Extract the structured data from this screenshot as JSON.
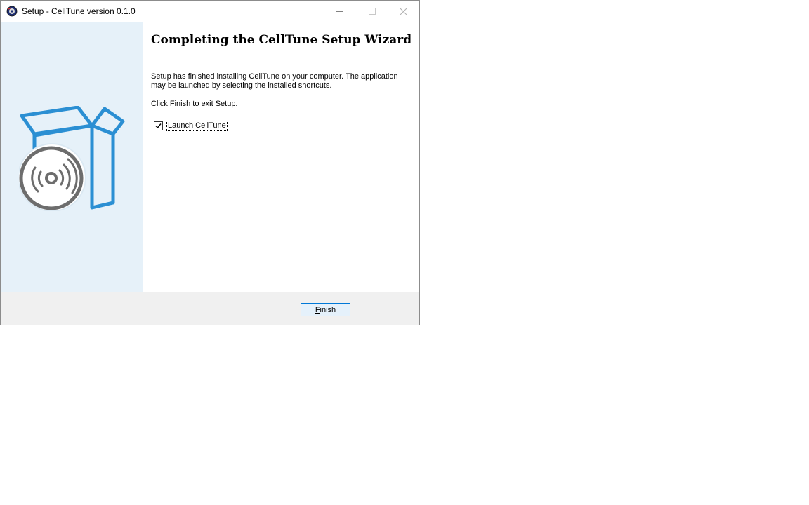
{
  "window": {
    "title": "Setup - CellTune version 0.1.0"
  },
  "titlebar_icons": {
    "app": "setup-app-icon",
    "minimize": "minimize-icon",
    "maximize": "maximize-icon",
    "close": "close-icon"
  },
  "sidebar": {
    "art": "software-box-disc-icon",
    "art_color": "#2b8fd3",
    "disc_color": "#6d6d6d"
  },
  "content": {
    "heading": "Completing the CellTune Setup Wizard",
    "paragraph1": "Setup has finished installing CellTune on your computer. The application may be launched by selecting the installed shortcuts.",
    "paragraph2": "Click Finish to exit Setup.",
    "launch_checkbox": {
      "label": "Launch CellTune",
      "checked": true
    }
  },
  "footer": {
    "finish_button": {
      "mnemonic": "F",
      "rest": "inish"
    }
  },
  "colors": {
    "sidebar_bg": "#e6f1f9",
    "button_border": "#0078d7",
    "footer_bg": "#f0f0f0"
  }
}
